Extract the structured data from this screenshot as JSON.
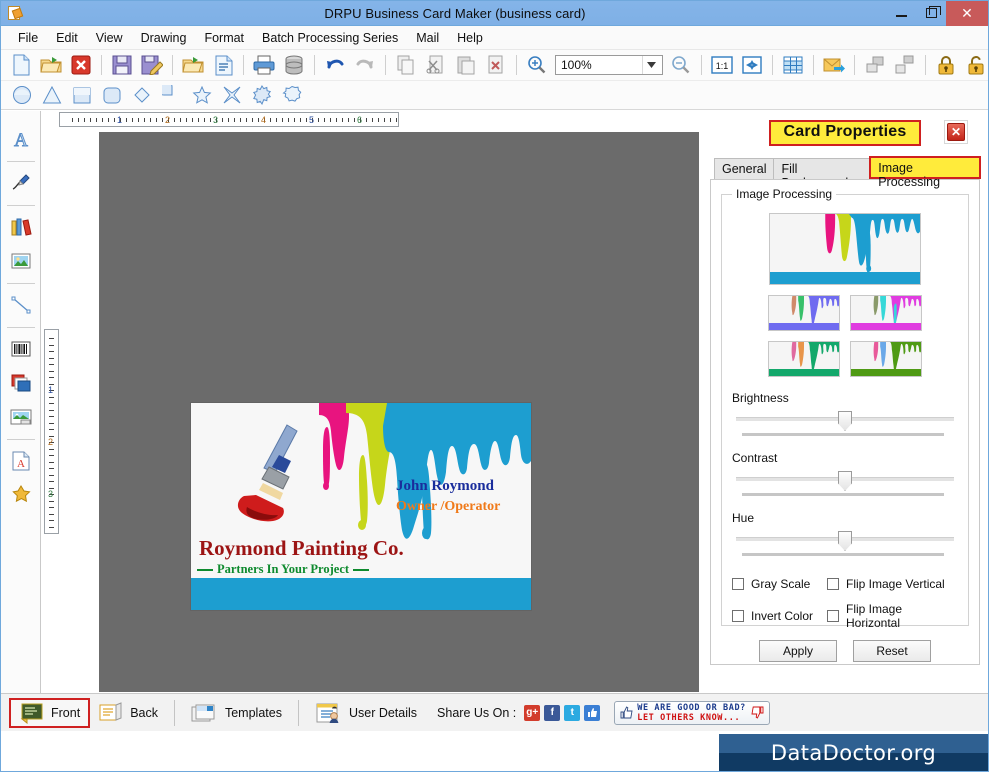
{
  "window": {
    "title": "DRPU Business Card Maker (business card)",
    "icon": "app-document-icon",
    "minimize_label": "–",
    "maximize_label": "□",
    "close_label": "✕",
    "titlebar_color": "#7fb0e6",
    "close_color": "#c85a5a"
  },
  "menubar": {
    "items": [
      {
        "label": "File"
      },
      {
        "label": "Edit"
      },
      {
        "label": "View"
      },
      {
        "label": "Drawing"
      },
      {
        "label": "Format"
      },
      {
        "label": "Batch Processing Series"
      },
      {
        "label": "Mail"
      },
      {
        "label": "Help"
      }
    ]
  },
  "toolbar": {
    "items": [
      {
        "name": "new-icon",
        "tip": "New"
      },
      {
        "name": "open-icon",
        "tip": "Open"
      },
      {
        "name": "delete-icon",
        "tip": "Delete"
      },
      {
        "name": "save-icon",
        "tip": "Save"
      },
      {
        "name": "save-as-icon",
        "tip": "Save As"
      },
      {
        "name": "import-icon",
        "tip": "Import"
      },
      {
        "name": "properties-icon",
        "tip": "Properties"
      },
      {
        "name": "print-icon",
        "tip": "Print"
      },
      {
        "name": "database-icon",
        "tip": "Database"
      },
      {
        "name": "undo-icon",
        "tip": "Undo"
      },
      {
        "name": "redo-icon",
        "tip": "Redo"
      },
      {
        "name": "copy-icon",
        "tip": "Copy"
      },
      {
        "name": "cut-icon",
        "tip": "Cut"
      },
      {
        "name": "paste-icon",
        "tip": "Paste"
      },
      {
        "name": "delete-object-icon",
        "tip": "Delete Object"
      },
      {
        "name": "zoom-in-icon",
        "tip": "Zoom In"
      },
      {
        "name": "zoom-out-icon",
        "tip": "Zoom Out"
      },
      {
        "name": "actual-size-icon",
        "tip": "1:1"
      },
      {
        "name": "fit-page-icon",
        "tip": "Fit Page"
      },
      {
        "name": "grid-icon",
        "tip": "Grid"
      },
      {
        "name": "mail-icon",
        "tip": "Mail"
      },
      {
        "name": "group-icon",
        "tip": "Group"
      },
      {
        "name": "ungroup-icon",
        "tip": "Ungroup"
      },
      {
        "name": "lock-icon",
        "tip": "Lock"
      },
      {
        "name": "unlock-icon",
        "tip": "Unlock"
      },
      {
        "name": "align-icon",
        "tip": "Align"
      }
    ],
    "zoom_value": "100%",
    "zoom_placeholder": "100%",
    "actual_size_label": "1:1"
  },
  "shapebar": {
    "items": [
      {
        "name": "ellipse-shape-icon"
      },
      {
        "name": "triangle-shape-icon"
      },
      {
        "name": "rectangle-shape-icon"
      },
      {
        "name": "rounded-rect-shape-icon"
      },
      {
        "name": "diamond-shape-icon"
      },
      {
        "name": "pie-shape-icon"
      },
      {
        "name": "star5-shape-icon"
      },
      {
        "name": "star4-shape-icon"
      },
      {
        "name": "burst-shape-icon"
      },
      {
        "name": "polygon-shape-icon"
      }
    ]
  },
  "left_rail": {
    "items": [
      {
        "name": "text-tool-icon"
      },
      {
        "name": "signature-tool-icon"
      },
      {
        "name": "barcode-library-icon"
      },
      {
        "name": "picture-tool-icon"
      },
      {
        "name": "line-tool-icon"
      },
      {
        "name": "barcode-tool-icon"
      },
      {
        "name": "layers-tool-icon"
      },
      {
        "name": "image-frame-tool-icon"
      },
      {
        "name": "watermark-tool-icon"
      },
      {
        "name": "star-tool-icon"
      }
    ]
  },
  "rulers": {
    "horizontal_labels": [
      "1",
      "2",
      "3",
      "4",
      "5",
      "6"
    ],
    "vertical_labels": [
      "1",
      "2",
      "3"
    ]
  },
  "card": {
    "name": "John Roymond",
    "role": "Owner /Operator",
    "company": "Roymond Painting Co.",
    "tagline": "Partners In Your Project",
    "colors": {
      "name": "#1a2d9c",
      "role": "#f07a1a",
      "company": "#9c1414",
      "tagline": "#0e8a2e",
      "band": "#1d9ed0",
      "background": "#f7f7f7",
      "drip_magenta": "#e8147f",
      "drip_lime": "#c6d61a",
      "drip_cyan": "#1d9ed0"
    }
  },
  "panel": {
    "title": "Card Properties",
    "close_label": "✕",
    "tabs": [
      {
        "label": "General",
        "active": false
      },
      {
        "label": "Fill Background",
        "active": false
      },
      {
        "label": "Image Processing",
        "active": true
      }
    ],
    "group_legend": "Image Processing",
    "thumbnails": [
      {
        "name": "thumb-main-cyan",
        "band": "#1d9ed0",
        "accent1": "#e8147f",
        "accent2": "#c6d61a",
        "accent3": "#1d9ed0"
      },
      {
        "name": "thumb-variant-blue",
        "band": "#6f6bf0",
        "accent1": "#d08a6a",
        "accent2": "#38c06a",
        "accent3": "#6f6bf0"
      },
      {
        "name": "thumb-variant-magenta",
        "band": "#e03ce0",
        "accent1": "#8a9a6a",
        "accent2": "#36d8d8",
        "accent3": "#e03ce0"
      },
      {
        "name": "thumb-variant-teal",
        "band": "#13a86b",
        "accent1": "#e06aa0",
        "accent2": "#e8954a",
        "accent3": "#13a86b"
      },
      {
        "name": "thumb-variant-green",
        "band": "#4f9a14",
        "accent1": "#e85a9a",
        "accent2": "#6aa8e8",
        "accent3": "#4f9a14"
      }
    ],
    "sliders": [
      {
        "label": "Brightness",
        "value": 50
      },
      {
        "label": "Contrast",
        "value": 50
      },
      {
        "label": "Hue",
        "value": 50
      }
    ],
    "checkboxes": [
      {
        "label": "Gray Scale",
        "checked": false
      },
      {
        "label": "Flip Image Vertical",
        "checked": false
      },
      {
        "label": "Invert Color",
        "checked": false
      },
      {
        "label": "Flip Image Horizontal",
        "checked": false
      }
    ],
    "apply_label": "Apply",
    "reset_label": "Reset"
  },
  "bottombar": {
    "pages": [
      {
        "label": "Front",
        "active": true,
        "icon": "card-front-icon"
      },
      {
        "label": "Back",
        "active": false,
        "icon": "card-back-icon"
      }
    ],
    "templates_label": "Templates",
    "user_details_label": "User Details",
    "share_label": "Share Us On :",
    "share_icons": [
      {
        "name": "google-plus-icon",
        "glyph": "g+",
        "color": "#d23c2c"
      },
      {
        "name": "facebook-icon",
        "glyph": "f",
        "color": "#3b5998"
      },
      {
        "name": "twitter-icon",
        "glyph": "t",
        "color": "#2caae1"
      },
      {
        "name": "thumbs-up-icon",
        "glyph": "👍",
        "color": "#3b7fd4"
      }
    ],
    "feedback_line1": "WE  ARE  GOOD  OR  BAD?",
    "feedback_line2": "LET OTHERS KNOW..."
  },
  "footer": {
    "brand": "DataDoctor.org",
    "brand_color": "#2f6091"
  }
}
